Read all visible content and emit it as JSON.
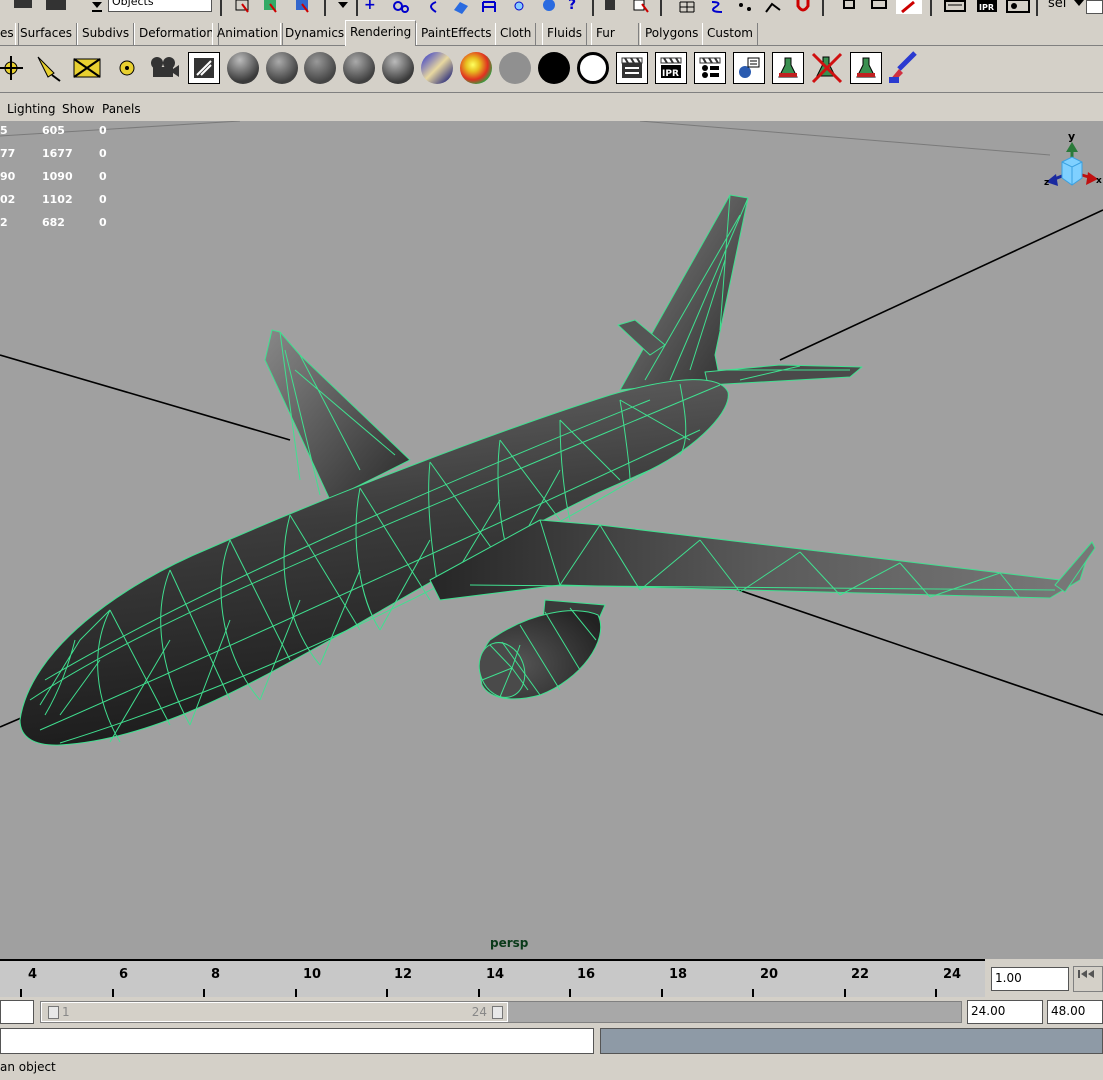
{
  "toolbar": {
    "mode_value": "Objects",
    "sel_label": "sel"
  },
  "shelf_tabs": [
    {
      "label": "es"
    },
    {
      "label": "Surfaces"
    },
    {
      "label": "Subdivs"
    },
    {
      "label": "Deformation"
    },
    {
      "label": "Animation"
    },
    {
      "label": "Dynamics"
    },
    {
      "label": "Rendering",
      "active": true
    },
    {
      "label": "PaintEffects"
    },
    {
      "label": "Cloth"
    },
    {
      "label": "Fluids"
    },
    {
      "label": "Fur"
    },
    {
      "label": "Polygons"
    },
    {
      "label": "Custom"
    }
  ],
  "shelf_icons": {
    "ipr_label": "IPR"
  },
  "panel_menu": {
    "lighting": "Lighting",
    "show": "Show",
    "panels": "Panels"
  },
  "hud_stats": [
    [
      "5",
      "605",
      "0"
    ],
    [
      "77",
      "1677",
      "0"
    ],
    [
      "90",
      "1090",
      "0"
    ],
    [
      "02",
      "1102",
      "0"
    ],
    [
      "2",
      "682",
      "0"
    ]
  ],
  "viewport": {
    "camera_label": "persp",
    "axis_y": "y",
    "axis_z": "z",
    "axis_x": "x"
  },
  "time_slider": {
    "tick_labels": [
      "4",
      "6",
      "8",
      "10",
      "12",
      "14",
      "16",
      "18",
      "20",
      "22",
      "24"
    ],
    "current_time": "1.00"
  },
  "range_slider": {
    "start_frame": "1",
    "end_frame": "24",
    "range_end": "24.00",
    "playback_end": "48.00"
  },
  "help_line": {
    "text": "an object"
  },
  "colors": {
    "viewport_bg": "#a0a0a0",
    "wireframe": "#40e090",
    "mesh_dark": "#3a3a3a",
    "ui_bg": "#d4d0c8"
  }
}
